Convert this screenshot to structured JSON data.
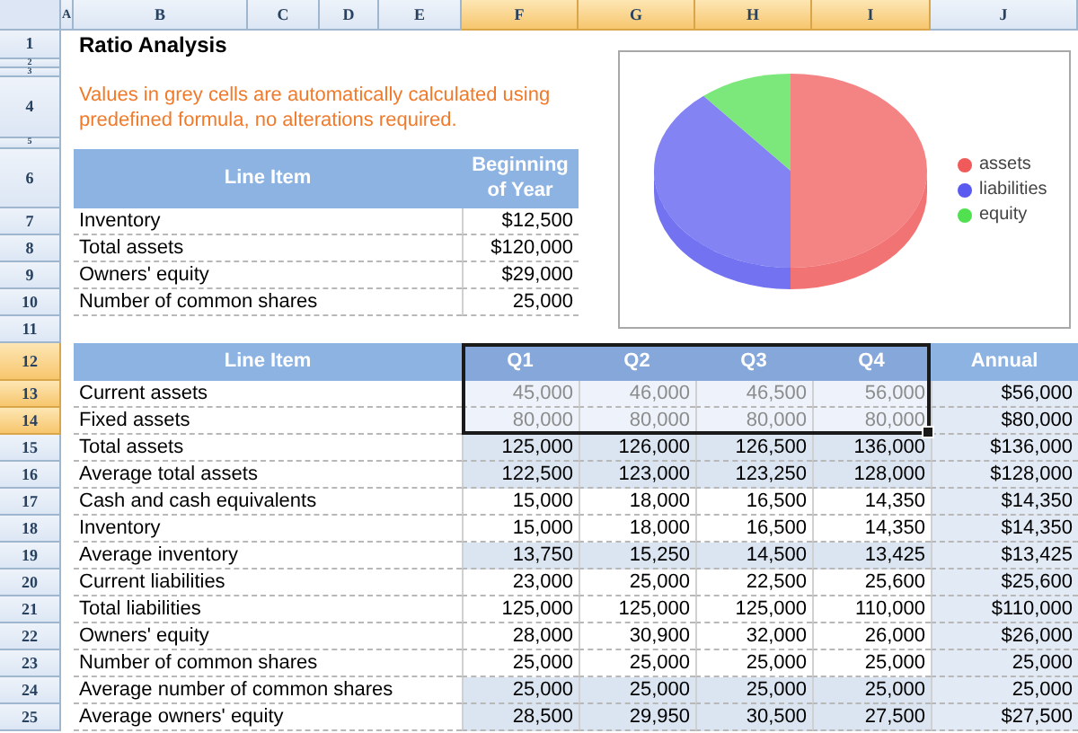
{
  "column_headers": [
    {
      "label": "A",
      "selected": false
    },
    {
      "label": "B",
      "selected": false
    },
    {
      "label": "C",
      "selected": false
    },
    {
      "label": "D",
      "selected": false
    },
    {
      "label": "E",
      "selected": false
    },
    {
      "label": "F",
      "selected": true
    },
    {
      "label": "G",
      "selected": true
    },
    {
      "label": "H",
      "selected": true
    },
    {
      "label": "I",
      "selected": true
    },
    {
      "label": "J",
      "selected": false
    }
  ],
  "row_headers": [
    {
      "label": "1",
      "selected": false
    },
    {
      "label": "2",
      "selected": false
    },
    {
      "label": "3",
      "selected": false
    },
    {
      "label": "4",
      "selected": false
    },
    {
      "label": "5",
      "selected": false
    },
    {
      "label": "6",
      "selected": false
    },
    {
      "label": "7",
      "selected": false
    },
    {
      "label": "8",
      "selected": false
    },
    {
      "label": "9",
      "selected": false
    },
    {
      "label": "10",
      "selected": false
    },
    {
      "label": "11",
      "selected": false
    },
    {
      "label": "12",
      "selected": true
    },
    {
      "label": "13",
      "selected": true
    },
    {
      "label": "14",
      "selected": true
    },
    {
      "label": "15",
      "selected": false
    },
    {
      "label": "16",
      "selected": false
    },
    {
      "label": "17",
      "selected": false
    },
    {
      "label": "18",
      "selected": false
    },
    {
      "label": "19",
      "selected": false
    },
    {
      "label": "20",
      "selected": false
    },
    {
      "label": "21",
      "selected": false
    },
    {
      "label": "22",
      "selected": false
    },
    {
      "label": "23",
      "selected": false
    },
    {
      "label": "24",
      "selected": false
    },
    {
      "label": "25",
      "selected": false
    }
  ],
  "title": "Ratio Analysis",
  "note": "Values in grey cells are automatically calculated using predefined formula, no alterations required.",
  "opening_table": {
    "columns": [
      "Line Item",
      "Beginning of Year"
    ],
    "rows": [
      {
        "label": "Inventory",
        "value": "$12,500"
      },
      {
        "label": "Total assets",
        "value": "$120,000"
      },
      {
        "label": "Owners' equity",
        "value": "$29,000"
      },
      {
        "label": "Number of common shares",
        "value": "25,000"
      }
    ]
  },
  "quarterly_table": {
    "columns": [
      "Line Item",
      "Q1",
      "Q2",
      "Q3",
      "Q4",
      "Annual"
    ],
    "rows": [
      {
        "label": "Current assets",
        "values": [
          "45,000",
          "46,000",
          "46,500",
          "56,000"
        ],
        "annual": "$56,000",
        "calculated": false
      },
      {
        "label": "Fixed assets",
        "values": [
          "80,000",
          "80,000",
          "80,000",
          "80,000"
        ],
        "annual": "$80,000",
        "calculated": false
      },
      {
        "label": "Total assets",
        "values": [
          "125,000",
          "126,000",
          "126,500",
          "136,000"
        ],
        "annual": "$136,000",
        "calculated": true
      },
      {
        "label": "Average total assets",
        "values": [
          "122,500",
          "123,000",
          "123,250",
          "128,000"
        ],
        "annual": "$128,000",
        "calculated": true
      },
      {
        "label": "Cash and cash equivalents",
        "values": [
          "15,000",
          "18,000",
          "16,500",
          "14,350"
        ],
        "annual": "$14,350",
        "calculated": false
      },
      {
        "label": "Inventory",
        "values": [
          "15,000",
          "18,000",
          "16,500",
          "14,350"
        ],
        "annual": "$14,350",
        "calculated": false
      },
      {
        "label": "Average inventory",
        "values": [
          "13,750",
          "15,250",
          "14,500",
          "13,425"
        ],
        "annual": "$13,425",
        "calculated": true
      },
      {
        "label": "Current liabilities",
        "values": [
          "23,000",
          "25,000",
          "22,500",
          "25,600"
        ],
        "annual": "$25,600",
        "calculated": false
      },
      {
        "label": "Total liabilities",
        "values": [
          "125,000",
          "125,000",
          "125,000",
          "110,000"
        ],
        "annual": "$110,000",
        "calculated": false
      },
      {
        "label": "Owners' equity",
        "values": [
          "28,000",
          "30,900",
          "32,000",
          "26,000"
        ],
        "annual": "$26,000",
        "calculated": false
      },
      {
        "label": "Number of common shares",
        "values": [
          "25,000",
          "25,000",
          "25,000",
          "25,000"
        ],
        "annual": "25,000",
        "calculated": false
      },
      {
        "label": "Average number of common shares",
        "values": [
          "25,000",
          "25,000",
          "25,000",
          "25,000"
        ],
        "annual": "25,000",
        "calculated": true
      },
      {
        "label": "Average owners' equity",
        "values": [
          "28,500",
          "29,950",
          "30,500",
          "27,500"
        ],
        "annual": "$27,500",
        "calculated": true
      }
    ]
  },
  "chart": {
    "legend": [
      {
        "label": "assets",
        "color": "#f05a5a"
      },
      {
        "label": "liabilities",
        "color": "#5a5af0"
      },
      {
        "label": "equity",
        "color": "#50e050"
      }
    ]
  }
}
